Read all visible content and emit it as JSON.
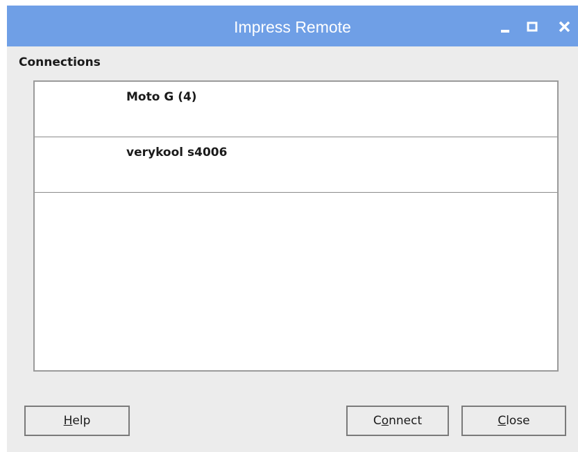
{
  "window": {
    "title": "Impress Remote",
    "controls": {
      "minimize_icon": "minimize-icon",
      "maximize_icon": "maximize-icon",
      "close_icon": "close-icon"
    }
  },
  "connections": {
    "label": "Connections",
    "devices": [
      {
        "name": "Moto G (4)"
      },
      {
        "name": "verykool s4006"
      }
    ]
  },
  "buttons": {
    "help": {
      "accel": "H",
      "rest": "elp"
    },
    "connect": {
      "pre": "C",
      "accel": "o",
      "rest": "nnect"
    },
    "close": {
      "accel": "C",
      "rest": "lose"
    }
  },
  "colors": {
    "titlebar": "#6f9fe6",
    "window_bg": "#ececec",
    "list_bg": "#ffffff"
  }
}
